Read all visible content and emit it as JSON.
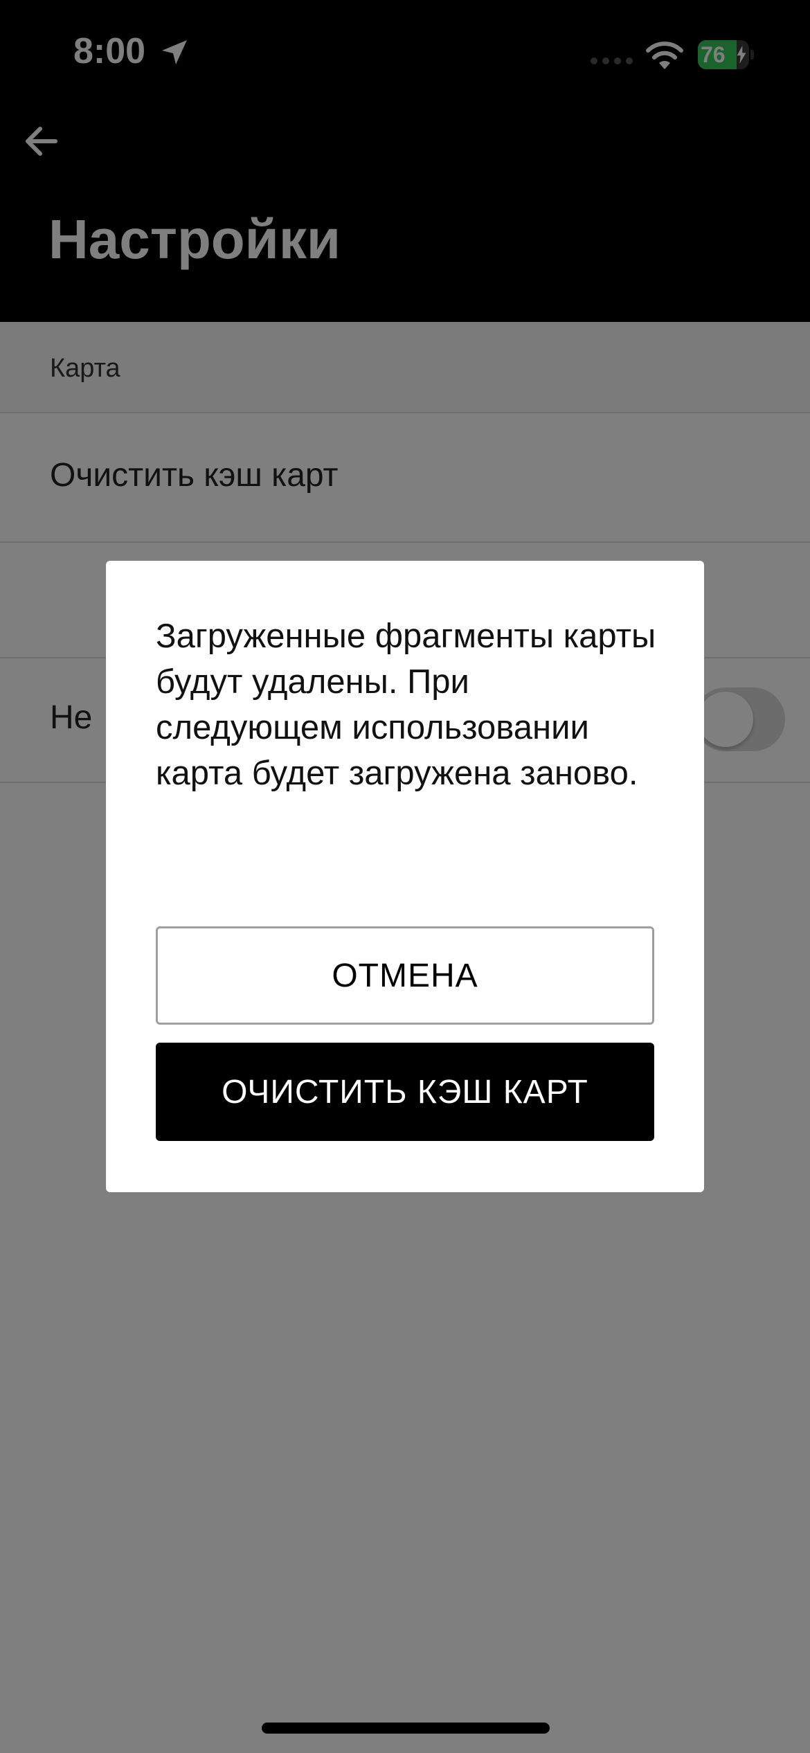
{
  "status_bar": {
    "time": "8:00",
    "battery_percent": "76",
    "battery_level": 0.76,
    "icons": [
      "location-arrow-icon",
      "cellular-signal-icon",
      "wifi-icon",
      "battery-charging-icon"
    ]
  },
  "header": {
    "back_icon": "arrow-left-icon",
    "title": "Настройки"
  },
  "list": {
    "section_header": "Карта",
    "items": [
      {
        "label": "Очистить кэш карт"
      },
      {
        "label": ""
      },
      {
        "label": "Не",
        "toggle_on": false
      }
    ]
  },
  "dialog": {
    "message": "Загруженные фрагменты карты будут удалены. При следующем использовании карта будет загружена заново.",
    "cancel_label": "ОТМЕНА",
    "confirm_label": "ОЧИСТИТЬ КЭШ КАРТ"
  },
  "colors": {
    "header_bg": "#000000",
    "scrim": "rgba(0,0,0,0.5)",
    "battery_green": "#34c759",
    "confirm_bg": "#000000"
  }
}
